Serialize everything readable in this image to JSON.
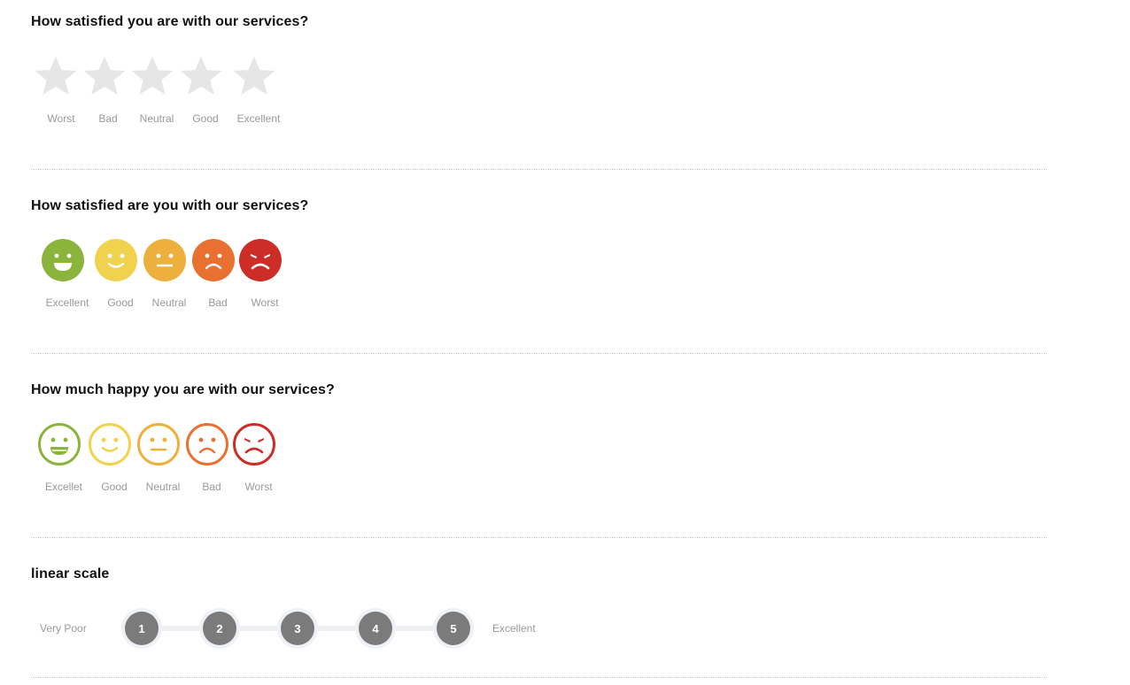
{
  "q1": {
    "title": "How satisfied you are with our services?",
    "options": [
      "Worst",
      "Bad",
      "Neutral",
      "Good",
      "Excellent"
    ],
    "star_color": "#e6e6e6",
    "rating": 0
  },
  "q2": {
    "title": "How satisfied are you with our services?",
    "options": [
      {
        "label": "Excellent",
        "icon": "laughing-face-icon",
        "color": "#8ab43c"
      },
      {
        "label": "Good",
        "icon": "smiling-face-icon",
        "color": "#f0d24e"
      },
      {
        "label": "Neutral",
        "icon": "neutral-face-icon",
        "color": "#eeb03c"
      },
      {
        "label": "Bad",
        "icon": "sad-face-icon",
        "color": "#e87031"
      },
      {
        "label": "Worst",
        "icon": "angry-face-icon",
        "color": "#cc2e27"
      }
    ]
  },
  "q3": {
    "title": "How much happy you are with our services?",
    "options": [
      {
        "label": "Excellet",
        "icon": "laughing-face-outline-icon",
        "color": "#8ab43c"
      },
      {
        "label": "Good",
        "icon": "smiling-face-outline-icon",
        "color": "#f0d24e"
      },
      {
        "label": "Neutral",
        "icon": "neutral-face-outline-icon",
        "color": "#eeb03c"
      },
      {
        "label": "Bad",
        "icon": "sad-face-outline-icon",
        "color": "#e87031"
      },
      {
        "label": "Worst",
        "icon": "angry-face-outline-icon",
        "color": "#cc2e27"
      }
    ]
  },
  "q4": {
    "title": "linear scale",
    "min_label": "Very Poor",
    "max_label": "Excellent",
    "values": [
      "1",
      "2",
      "3",
      "4",
      "5"
    ],
    "node_color": "#7b7b7b"
  }
}
